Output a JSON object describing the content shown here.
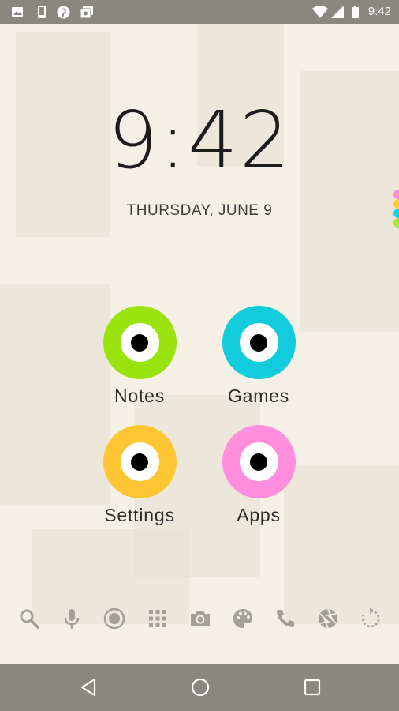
{
  "statusbar": {
    "time": "9:42",
    "left_icons": [
      "gallery-icon",
      "phone-notification-icon",
      "pinterest-icon",
      "photo-notification-icon"
    ],
    "right_icons": [
      "wifi-icon",
      "signal-icon",
      "battery-icon"
    ]
  },
  "clock": {
    "time": "9:42",
    "date": "THURSDAY, JUNE 9"
  },
  "edge_tab_colors": [
    "#ff8fd6",
    "#ffc83d",
    "#1fd3e0",
    "#a8e63a"
  ],
  "apps": [
    {
      "label": "Notes",
      "color": "#9be30f"
    },
    {
      "label": "Games",
      "color": "#12cbdc"
    },
    {
      "label": "Settings",
      "color": "#ffc634"
    },
    {
      "label": "Apps",
      "color": "#ff8fdc"
    }
  ],
  "dock": {
    "icons": [
      "search-icon",
      "microphone-icon",
      "record-icon",
      "app-grid-icon",
      "camera-icon",
      "palette-icon",
      "phone-icon",
      "aperture-icon",
      "refresh-icon"
    ]
  },
  "navbar": {
    "buttons": [
      "back-icon",
      "home-icon",
      "recents-icon"
    ]
  }
}
